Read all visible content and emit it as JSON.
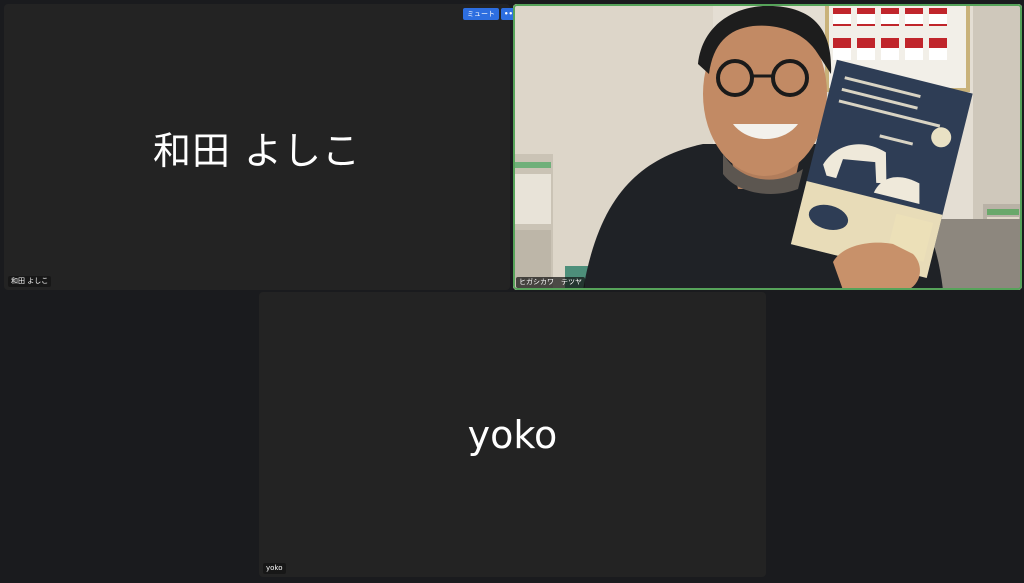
{
  "participants": [
    {
      "name": "和田 よしこ",
      "label": "和田 よしこ",
      "video": false
    },
    {
      "name": "ヒガシカワ　テツヤ",
      "label": "ヒガシカワ　テツヤ",
      "video": true,
      "book": {
        "title_lines": [
          "探していたものは",
          "どこかでもある",
          "小さな　一つの言葉だった"
        ],
        "author": "若松英輔"
      }
    },
    {
      "name": "yoko",
      "label": "yoko",
      "video": false
    }
  ],
  "toolbar": {
    "mute_label": "ミュート",
    "more_label": "•••"
  },
  "colors": {
    "active_border": "#56a35a",
    "button": "#2d6ee0",
    "tile_bg": "#232323",
    "app_bg": "#1a1b1e"
  }
}
